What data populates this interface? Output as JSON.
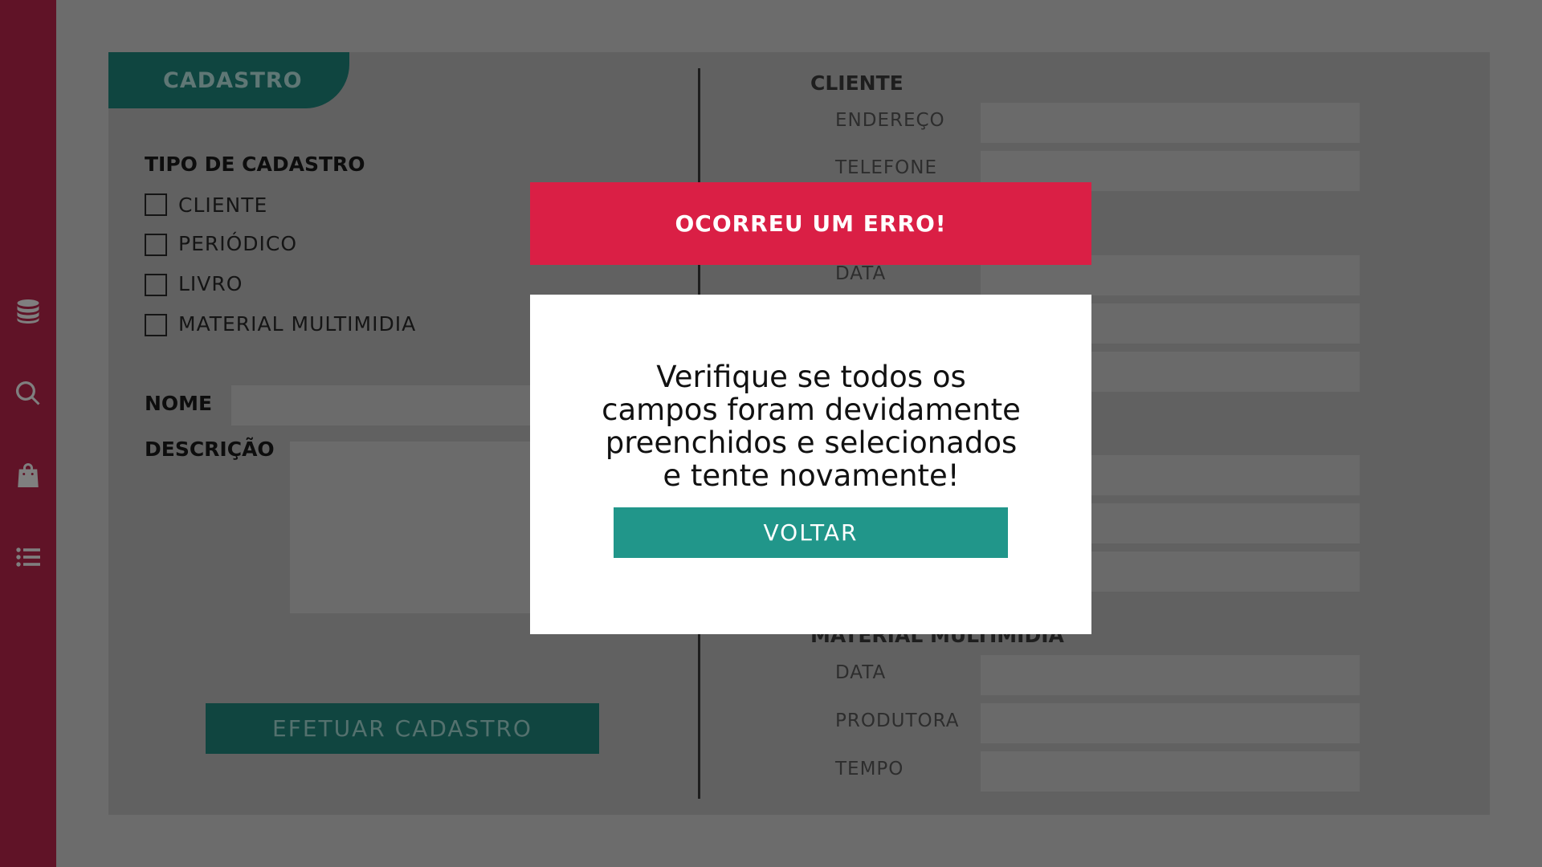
{
  "sidebar": {
    "icons": [
      "database-icon",
      "search-icon",
      "shopping-bag-icon",
      "list-icon"
    ],
    "color": "#c0264e"
  },
  "form": {
    "tab_label": "CADASTRO",
    "tipo_title": "TIPO DE CADASTRO",
    "options": [
      "CLIENTE",
      "PERIÓDICO",
      "LIVRO",
      "MATERIAL MULTIMIDIA"
    ],
    "nome_label": "NOME",
    "descricao_label": "DESCRIÇÃO",
    "submit_label": "EFETUAR CADASTRO",
    "accent": "#1e8a81"
  },
  "right": {
    "cliente_title": "CLIENTE",
    "cliente_fields": [
      "ENDEREÇO",
      "TELEFONE"
    ],
    "periodico_fields": [
      "DATA"
    ],
    "multimidia_title": "MATERIAL MULTIMIDIA",
    "multimidia_fields": [
      "DATA",
      "PRODUTORA",
      "TEMPO"
    ]
  },
  "modal": {
    "title": "OCORREU UM ERRO!",
    "message": "Verifique se todos os campos foram devidamente preenchidos e selecionados e tente novamente!",
    "button_label": "VOLTAR",
    "header_color": "#da1f45",
    "button_color": "#21968a"
  }
}
